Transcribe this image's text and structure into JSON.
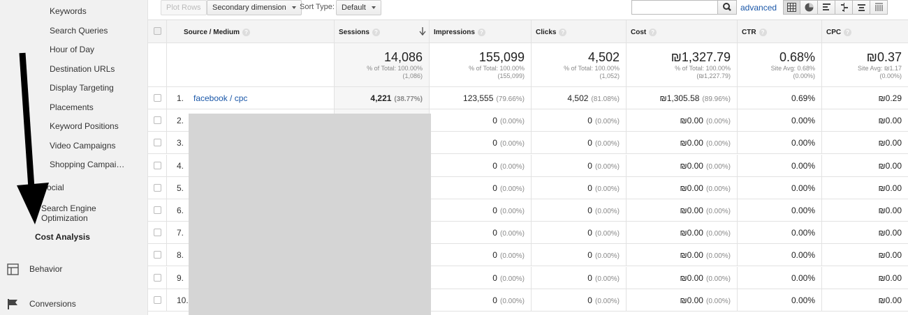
{
  "sidebar": {
    "items": [
      {
        "label": "Keywords"
      },
      {
        "label": "Search Queries"
      },
      {
        "label": "Hour of Day"
      },
      {
        "label": "Destination URLs"
      },
      {
        "label": "Display Targeting"
      },
      {
        "label": "Placements"
      },
      {
        "label": "Keyword Positions"
      },
      {
        "label": "Video Campaigns"
      },
      {
        "label": "Shopping Campai…"
      }
    ],
    "social": "Social",
    "seo_line1": "Search Engine",
    "seo_line2": "Optimization",
    "cost_analysis": "Cost Analysis",
    "behavior": "Behavior",
    "conversions": "Conversions"
  },
  "toolbar": {
    "plot_rows": "Plot Rows",
    "secondary_dimension": "Secondary dimension",
    "sort_type_label": "Sort Type:",
    "sort_type_value": "Default",
    "search_value": "",
    "advanced": "advanced"
  },
  "table": {
    "headers": {
      "source_medium": "Source / Medium",
      "sessions": "Sessions",
      "impressions": "Impressions",
      "clicks": "Clicks",
      "cost": "Cost",
      "ctr": "CTR",
      "cpc": "CPC"
    },
    "totals": {
      "sessions": {
        "value": "14,086",
        "line1": "% of Total: 100.00%",
        "line2": "(1,086)"
      },
      "impressions": {
        "value": "155,099",
        "line1": "% of Total: 100.00%",
        "line2": "(155,099)"
      },
      "clicks": {
        "value": "4,502",
        "line1": "% of Total: 100.00%",
        "line2": "(1,052)"
      },
      "cost": {
        "value": "₪1,327.79",
        "line1": "% of Total: 100.00%",
        "line2": "(₪1,227.79)"
      },
      "ctr": {
        "value": "0.68%",
        "line1": "Site Avg: 0.68%",
        "line2": "(0.00%)"
      },
      "cpc": {
        "value": "₪0.37",
        "line1": "Site Avg: ₪1.17",
        "line2": "(0.00%)"
      }
    },
    "rows": [
      {
        "idx": "1.",
        "source": "facebook / cpc",
        "sessions": "4,221",
        "sessions_pct": "(38.77%)",
        "impressions": "123,555",
        "impressions_pct": "(79.66%)",
        "clicks": "4,502",
        "clicks_pct": "(81.08%)",
        "cost": "₪1,305.58",
        "cost_pct": "(89.96%)",
        "ctr": "0.69%",
        "cpc": "₪0.29"
      },
      {
        "idx": "2.",
        "source": "",
        "sessions": "",
        "sessions_pct": "",
        "impressions": "0",
        "impressions_pct": "(0.00%)",
        "clicks": "0",
        "clicks_pct": "(0.00%)",
        "cost": "₪0.00",
        "cost_pct": "(0.00%)",
        "ctr": "0.00%",
        "cpc": "₪0.00"
      },
      {
        "idx": "3.",
        "source": "",
        "sessions": "",
        "sessions_pct": "",
        "impressions": "0",
        "impressions_pct": "(0.00%)",
        "clicks": "0",
        "clicks_pct": "(0.00%)",
        "cost": "₪0.00",
        "cost_pct": "(0.00%)",
        "ctr": "0.00%",
        "cpc": "₪0.00"
      },
      {
        "idx": "4.",
        "source": "",
        "sessions": "",
        "sessions_pct": "",
        "impressions": "0",
        "impressions_pct": "(0.00%)",
        "clicks": "0",
        "clicks_pct": "(0.00%)",
        "cost": "₪0.00",
        "cost_pct": "(0.00%)",
        "ctr": "0.00%",
        "cpc": "₪0.00"
      },
      {
        "idx": "5.",
        "source": "",
        "sessions": "",
        "sessions_pct": "",
        "impressions": "0",
        "impressions_pct": "(0.00%)",
        "clicks": "0",
        "clicks_pct": "(0.00%)",
        "cost": "₪0.00",
        "cost_pct": "(0.00%)",
        "ctr": "0.00%",
        "cpc": "₪0.00"
      },
      {
        "idx": "6.",
        "source": "",
        "sessions": "",
        "sessions_pct": "",
        "impressions": "0",
        "impressions_pct": "(0.00%)",
        "clicks": "0",
        "clicks_pct": "(0.00%)",
        "cost": "₪0.00",
        "cost_pct": "(0.00%)",
        "ctr": "0.00%",
        "cpc": "₪0.00"
      },
      {
        "idx": "7.",
        "source": "",
        "sessions": "",
        "sessions_pct": "",
        "impressions": "0",
        "impressions_pct": "(0.00%)",
        "clicks": "0",
        "clicks_pct": "(0.00%)",
        "cost": "₪0.00",
        "cost_pct": "(0.00%)",
        "ctr": "0.00%",
        "cpc": "₪0.00"
      },
      {
        "idx": "8.",
        "source": "",
        "sessions": "",
        "sessions_pct": "",
        "impressions": "0",
        "impressions_pct": "(0.00%)",
        "clicks": "0",
        "clicks_pct": "(0.00%)",
        "cost": "₪0.00",
        "cost_pct": "(0.00%)",
        "ctr": "0.00%",
        "cpc": "₪0.00"
      },
      {
        "idx": "9.",
        "source": "",
        "sessions": "",
        "sessions_pct": "",
        "impressions": "0",
        "impressions_pct": "(0.00%)",
        "clicks": "0",
        "clicks_pct": "(0.00%)",
        "cost": "₪0.00",
        "cost_pct": "(0.00%)",
        "ctr": "0.00%",
        "cpc": "₪0.00"
      },
      {
        "idx": "10.",
        "source": "",
        "sessions": "",
        "sessions_pct": "",
        "impressions": "0",
        "impressions_pct": "(0.00%)",
        "clicks": "0",
        "clicks_pct": "(0.00%)",
        "cost": "₪0.00",
        "cost_pct": "(0.00%)",
        "ctr": "0.00%",
        "cpc": "₪0.00"
      }
    ]
  }
}
